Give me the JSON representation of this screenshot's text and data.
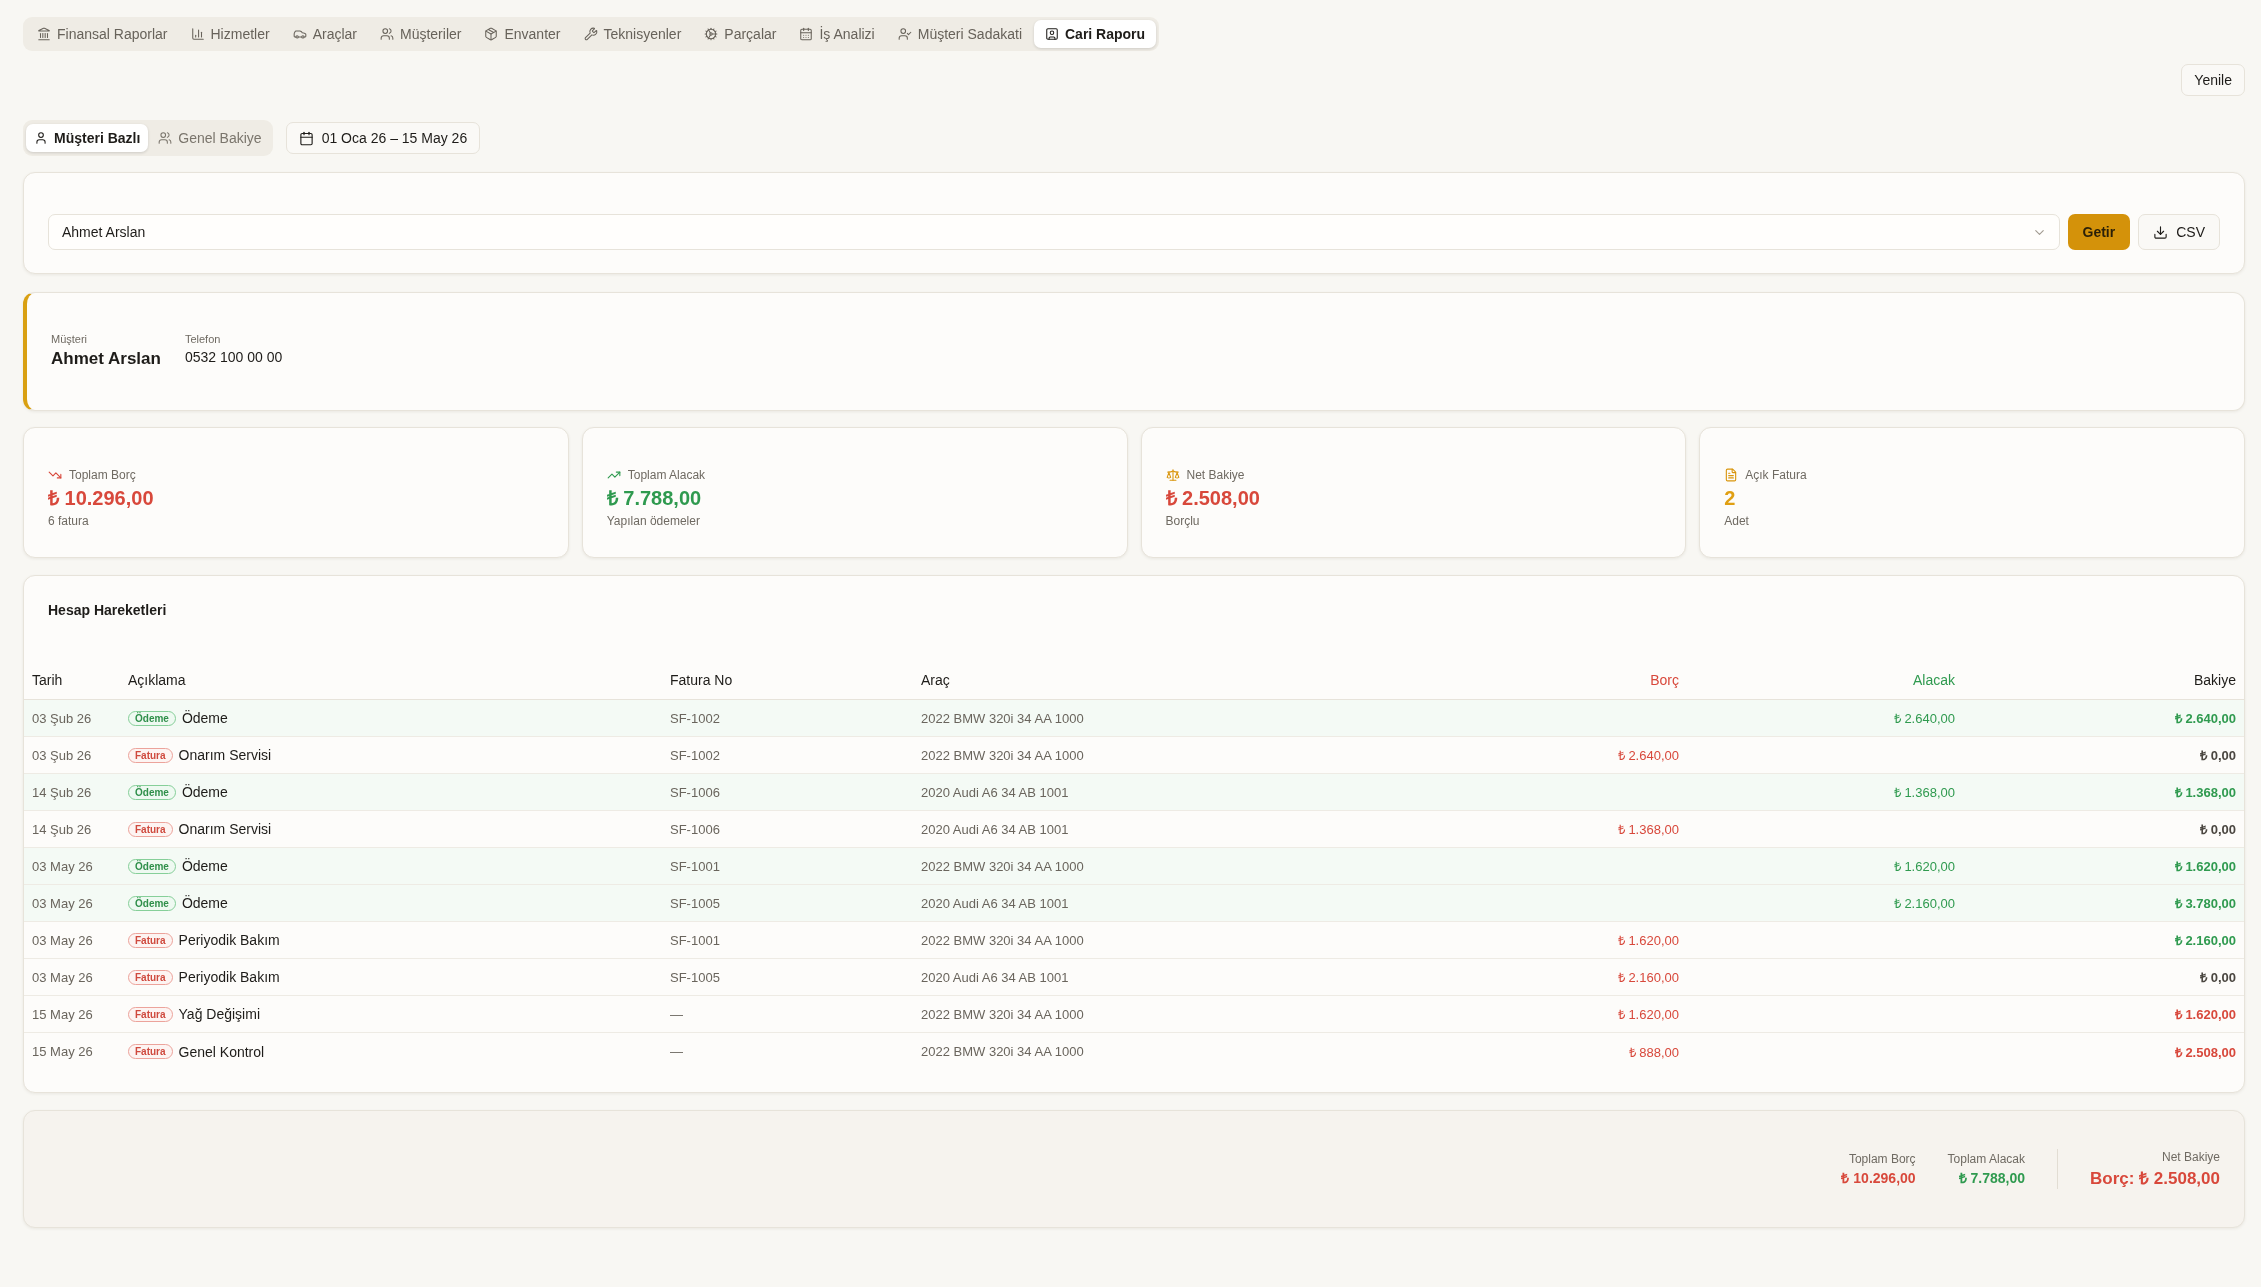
{
  "nav_tabs": [
    {
      "label": "Finansal Raporlar",
      "selected": false
    },
    {
      "label": "Hizmetler",
      "selected": false
    },
    {
      "label": "Araçlar",
      "selected": false
    },
    {
      "label": "Müşteriler",
      "selected": false
    },
    {
      "label": "Envanter",
      "selected": false
    },
    {
      "label": "Teknisyenler",
      "selected": false
    },
    {
      "label": "Parçalar",
      "selected": false
    },
    {
      "label": "İş Analizi",
      "selected": false
    },
    {
      "label": "Müşteri Sadakati",
      "selected": false
    },
    {
      "label": "Cari Raporu",
      "selected": true
    }
  ],
  "refresh_button": "Yenile",
  "view_toggle": [
    {
      "label": "Müşteri Bazlı",
      "selected": true
    },
    {
      "label": "Genel Bakiye",
      "selected": false
    }
  ],
  "date_range": "01 Oca 26 – 15 May 26",
  "customer_select": {
    "value": "Ahmet Arslan"
  },
  "fetch_button": "Getir",
  "export_button": "CSV",
  "customer": {
    "label": "Müşteri",
    "name": "Ahmet Arslan",
    "phone_label": "Telefon",
    "phone": "0532 100 00 00"
  },
  "stats": [
    {
      "kind": "debt",
      "label": "Toplam Borç",
      "value": "₺ 10.296,00",
      "note": "6 fatura",
      "color": "#d8483b"
    },
    {
      "kind": "credit",
      "label": "Toplam Alacak",
      "value": "₺ 7.788,00",
      "note": "Yapılan ödemeler",
      "color": "#2f9a4f"
    },
    {
      "kind": "balance",
      "label": "Net Bakiye",
      "value": "₺ 2.508,00",
      "note": "Borçlu",
      "color": "#d8483b"
    },
    {
      "kind": "open_invoices",
      "label": "Açık Fatura",
      "value": "2",
      "note": "Adet",
      "color": "#e09f12"
    }
  ],
  "ledger": {
    "title": "Hesap Hareketleri",
    "columns": [
      {
        "label": "Tarih",
        "kind": "text"
      },
      {
        "label": "Açıklama",
        "kind": "text"
      },
      {
        "label": "Fatura No",
        "kind": "text"
      },
      {
        "label": "Araç",
        "kind": "text"
      },
      {
        "label": "Borç",
        "kind": "debit"
      },
      {
        "label": "Alacak",
        "kind": "credit"
      },
      {
        "label": "Bakiye",
        "kind": "balance"
      }
    ],
    "rows": [
      {
        "kind": "payment",
        "date": "03 Şub 26",
        "badge": "Ödeme",
        "description": "Ödeme",
        "invoice_no": "SF-1002",
        "vehicle": "2022 BMW 320i 34 AA 1000",
        "credit": "₺ 2.640,00",
        "balance": {
          "kind": "credit",
          "value": "₺ 2.640,00"
        }
      },
      {
        "kind": "invoice",
        "date": "03 Şub 26",
        "badge": "Fatura",
        "description": "Onarım Servisi",
        "invoice_no": "SF-1002",
        "vehicle": "2022 BMW 320i 34 AA 1000",
        "debit": "₺ 2.640,00",
        "balance": {
          "kind": "zero",
          "value": "₺ 0,00"
        }
      },
      {
        "kind": "payment",
        "date": "14 Şub 26",
        "badge": "Ödeme",
        "description": "Ödeme",
        "invoice_no": "SF-1006",
        "vehicle": "2020 Audi A6 34 AB 1001",
        "credit": "₺ 1.368,00",
        "balance": {
          "kind": "credit",
          "value": "₺ 1.368,00"
        }
      },
      {
        "kind": "invoice",
        "date": "14 Şub 26",
        "badge": "Fatura",
        "description": "Onarım Servisi",
        "invoice_no": "SF-1006",
        "vehicle": "2020 Audi A6 34 AB 1001",
        "debit": "₺ 1.368,00",
        "balance": {
          "kind": "zero",
          "value": "₺ 0,00"
        }
      },
      {
        "kind": "payment",
        "date": "03 May 26",
        "badge": "Ödeme",
        "description": "Ödeme",
        "invoice_no": "SF-1001",
        "vehicle": "2022 BMW 320i 34 AA 1000",
        "credit": "₺ 1.620,00",
        "balance": {
          "kind": "credit",
          "value": "₺ 1.620,00"
        }
      },
      {
        "kind": "payment",
        "date": "03 May 26",
        "badge": "Ödeme",
        "description": "Ödeme",
        "invoice_no": "SF-1005",
        "vehicle": "2020 Audi A6 34 AB 1001",
        "credit": "₺ 2.160,00",
        "balance": {
          "kind": "credit",
          "value": "₺ 3.780,00"
        }
      },
      {
        "kind": "invoice",
        "date": "03 May 26",
        "badge": "Fatura",
        "description": "Periyodik Bakım",
        "invoice_no": "SF-1001",
        "vehicle": "2022 BMW 320i 34 AA 1000",
        "debit": "₺ 1.620,00",
        "balance": {
          "kind": "credit",
          "value": "₺ 2.160,00"
        }
      },
      {
        "kind": "invoice",
        "date": "03 May 26",
        "badge": "Fatura",
        "description": "Periyodik Bakım",
        "invoice_no": "SF-1005",
        "vehicle": "2020 Audi A6 34 AB 1001",
        "debit": "₺ 2.160,00",
        "balance": {
          "kind": "zero",
          "value": "₺ 0,00"
        }
      },
      {
        "kind": "invoice",
        "date": "15 May 26",
        "badge": "Fatura",
        "description": "Yağ Değişimi",
        "invoice_no": "—",
        "vehicle": "2022 BMW 320i 34 AA 1000",
        "debit": "₺ 1.620,00",
        "balance": {
          "kind": "debit",
          "value": "₺ 1.620,00"
        }
      },
      {
        "kind": "invoice",
        "date": "15 May 26",
        "badge": "Fatura",
        "description": "Genel Kontrol",
        "invoice_no": "—",
        "vehicle": "2022 BMW 320i 34 AA 1000",
        "debit": "₺ 888,00",
        "balance": {
          "kind": "debit",
          "value": "₺ 2.508,00"
        }
      }
    ]
  },
  "totals": {
    "items": [
      {
        "kind": "debit",
        "label": "Toplam Borç",
        "value": "₺ 10.296,00"
      },
      {
        "kind": "credit",
        "label": "Toplam Alacak",
        "value": "₺ 7.788,00"
      }
    ],
    "net": {
      "kind": "debit",
      "label": "Net Bakiye",
      "value": "Borç: ₺ 2.508,00"
    }
  }
}
